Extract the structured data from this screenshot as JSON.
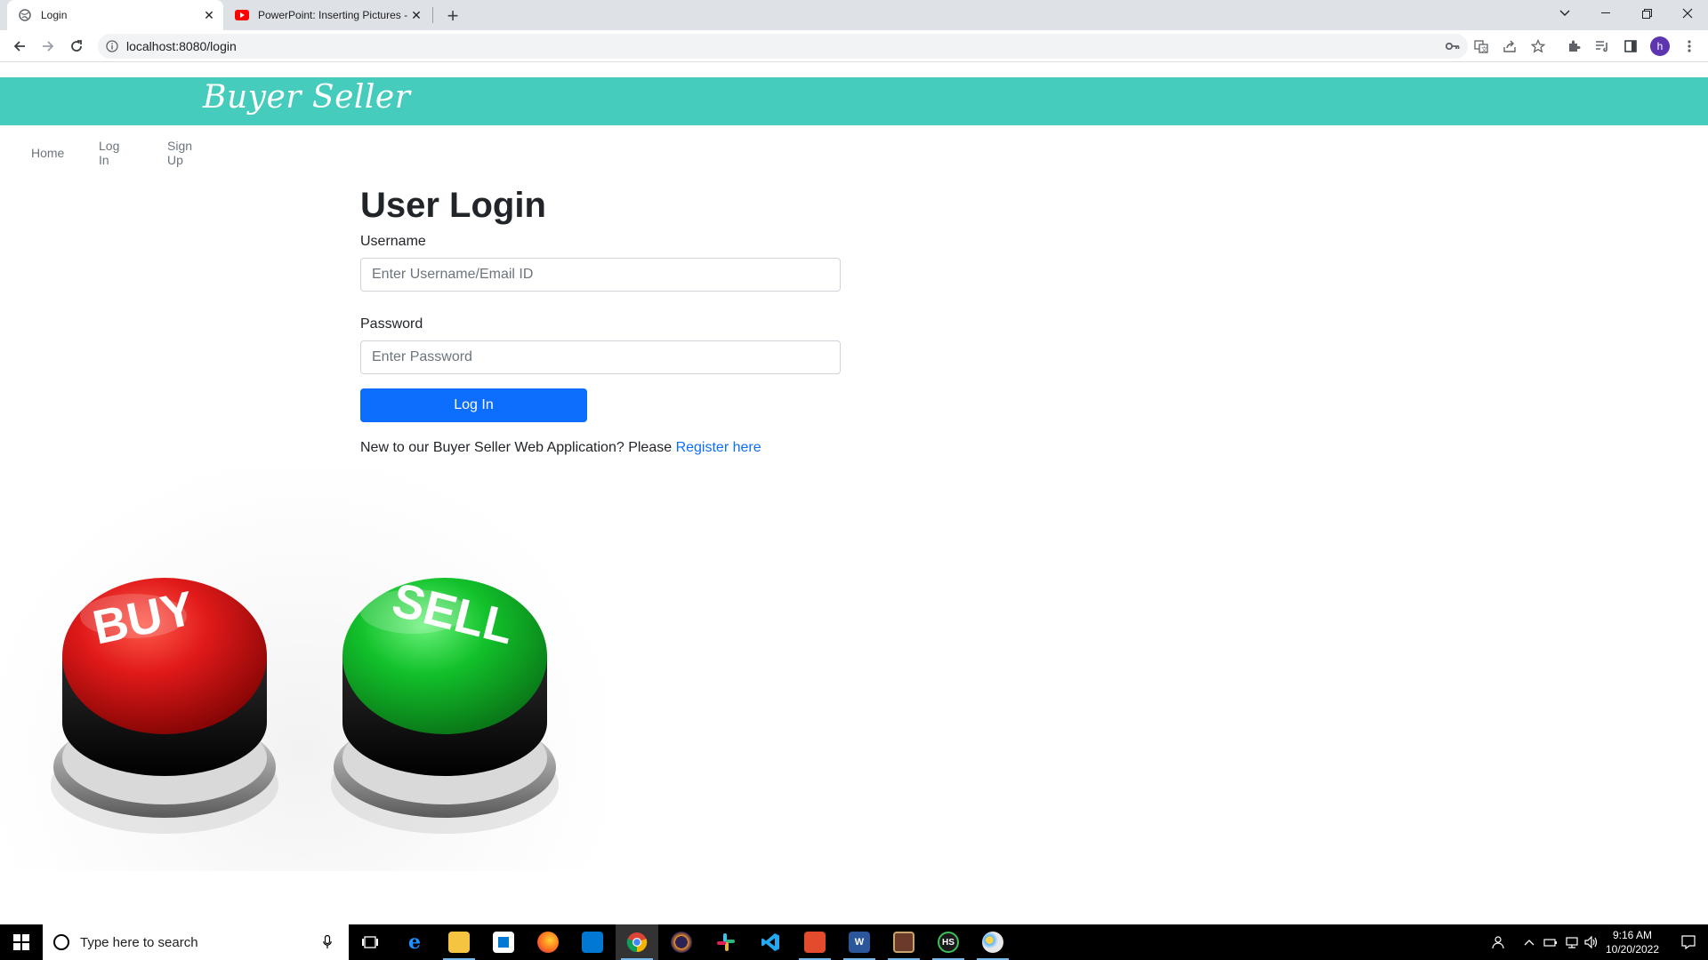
{
  "browser": {
    "tabs": [
      {
        "title": "Login",
        "active": true
      },
      {
        "title": "PowerPoint: Inserting Pictures - Y",
        "active": false
      }
    ],
    "address": "localhost:8080/login",
    "profile_initial": "h"
  },
  "page": {
    "brand": "Buyer Seller",
    "nav": [
      "Home",
      "Log In",
      "Sign Up"
    ],
    "login": {
      "heading": "User Login",
      "username_label": "Username",
      "username_placeholder": "Enter Username/Email ID",
      "password_label": "Password",
      "password_placeholder": "Enter Password",
      "button": "Log In",
      "note_text": "New to our Buyer Seller Web Application? Please ",
      "register_link": "Register here"
    },
    "hero": {
      "buy_text": "BUY",
      "sell_text": "SELL"
    }
  },
  "taskbar": {
    "search_placeholder": "Type here to search",
    "time": "9:16 AM",
    "date": "10/20/2022"
  },
  "colors": {
    "brand_bar": "#45ccbc",
    "primary_button": "#0d6efd",
    "buy_button": "#d11414",
    "sell_button": "#12c12b"
  }
}
